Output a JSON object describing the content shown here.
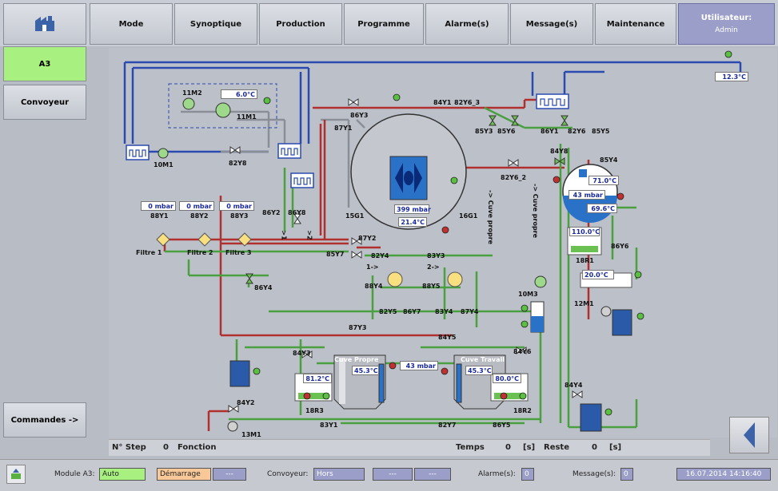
{
  "nav": {
    "mode": "Mode",
    "synoptique": "Synoptique",
    "production": "Production",
    "programme": "Programme",
    "alarmes": "Alarme(s)",
    "messages": "Message(s)",
    "maintenance": "Maintenance",
    "user_title": "Utilisateur:",
    "user_name": "Admin"
  },
  "sidebar": {
    "a3": "A3",
    "convoyeur": "Convoyeur",
    "commandes": "Commandes ->"
  },
  "diagram": {
    "m11m2": "11M2",
    "m11m1": "11M1",
    "m10m1": "10M1",
    "v82y8": "82Y8",
    "temp_top": "6.0°C",
    "temp_right_top": "12.3°C",
    "v88y1": "88Y1",
    "v88y2": "88Y2",
    "v88y3": "88Y3",
    "p1": "0 mbar",
    "p2": "0 mbar",
    "p3": "0 mbar",
    "filtre1": "Filtre 1",
    "filtre2": "Filtre 2",
    "filtre3": "Filtre 3",
    "v86y2": "86Y2",
    "v86y8": "86Y8",
    "v1": ">1",
    "v2": ">2",
    "v86y3": "86Y3",
    "v87y1": "87Y1",
    "v84y1": "84Y1",
    "v82y6_3": "82Y6_3",
    "v85y3": "85Y3",
    "v85y6": "85Y6",
    "v86y1": "86Y1",
    "v82y6": "82Y6",
    "v85y5": "85Y5",
    "v84y8": "84Y8",
    "v85y4": "85Y4",
    "v82y6_2": "82Y6_2",
    "reactor_pressure": "399 mbar",
    "reactor_temp": "21.4°C",
    "g15": "15G1",
    "g16": "16G1",
    "cuve_propre_pipe": "-> Cuve propre",
    "sep_temp": "71.0°C",
    "sep_pressure": "43 mbar",
    "sep_temp2": "69.6°C",
    "r1_temp": "110.0°C",
    "r1_label": "18R1",
    "v86y6": "86Y6",
    "cool_temp": "20.0°C",
    "m12m1": "12M1",
    "v87y2": "87Y2",
    "v85y7": "85Y7",
    "v82y4": "82Y4",
    "v83y3": "83Y3",
    "arrow1": "1->",
    "arrow2": "2->",
    "v88y4": "88Y4",
    "v88y5": "88Y5",
    "v82y5": "82Y5",
    "v86y7": "86Y7",
    "v83y4": "83Y4",
    "v87y4": "87Y4",
    "v86y4": "86Y4",
    "m10m3": "10M3",
    "v87y3": "87Y3",
    "v84y5": "84Y5",
    "v84y3": "84Y3",
    "v84y6": "84Y6",
    "cuve_propre": "Cuve Propre",
    "cuve_propre_temp": "45.3°C",
    "cuve_travail": "Cuve Travail",
    "cuve_travail_temp": "45.3°C",
    "mid_pressure": "43 mbar",
    "r3_temp": "81.2°C",
    "r3_label": "18R3",
    "r2_temp": "80.0°C",
    "r2_label": "18R2",
    "v84y2": "84Y2",
    "m13m1": "13M1",
    "v83y1": "83Y1",
    "v82y7": "82Y7",
    "v86y5": "86Y5",
    "v84y4": "84Y4"
  },
  "infobar": {
    "step_label": "N° Step",
    "step_value": "0",
    "fonction_label": "Fonction",
    "temps_label": "Temps",
    "temps_value": "0",
    "temps_unit": "[s]",
    "reste_label": "Reste",
    "reste_value": "0",
    "reste_unit": "[s]"
  },
  "status": {
    "module_label": "Module A3:",
    "module_value": "Auto",
    "phase_value": "Démarrage",
    "phase_extra": "---",
    "convoyeur_label": "Convoyeur:",
    "convoyeur_value": "Hors",
    "f1": "---",
    "f2": "---",
    "alarmes_label": "Alarme(s):",
    "alarmes_value": "0",
    "messages_label": "Message(s):",
    "messages_value": "0",
    "datetime": "16.07.2014 14:16:40"
  },
  "colors": {
    "hot_pipe": "#b03030",
    "cold_pipe": "#2a4ab0",
    "green_pipe": "#4aa040",
    "active": "#a8f080"
  }
}
